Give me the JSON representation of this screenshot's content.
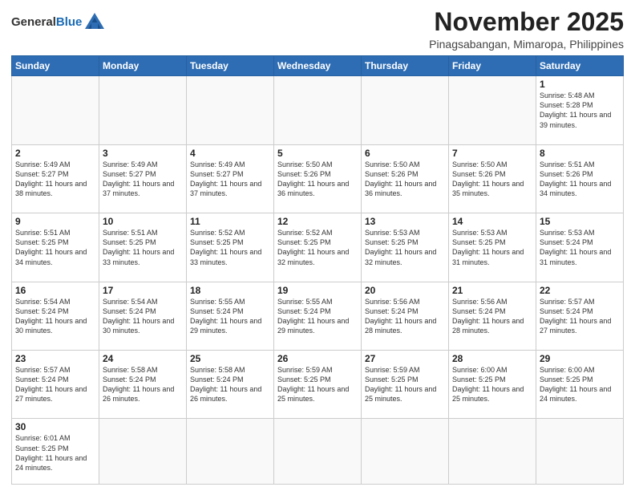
{
  "header": {
    "logo_general": "General",
    "logo_blue": "Blue",
    "month": "November 2025",
    "location": "Pinagsabangan, Mimaropa, Philippines"
  },
  "weekdays": [
    "Sunday",
    "Monday",
    "Tuesday",
    "Wednesday",
    "Thursday",
    "Friday",
    "Saturday"
  ],
  "weeks": [
    [
      {
        "day": "",
        "info": ""
      },
      {
        "day": "",
        "info": ""
      },
      {
        "day": "",
        "info": ""
      },
      {
        "day": "",
        "info": ""
      },
      {
        "day": "",
        "info": ""
      },
      {
        "day": "",
        "info": ""
      },
      {
        "day": "1",
        "info": "Sunrise: 5:48 AM\nSunset: 5:28 PM\nDaylight: 11 hours\nand 39 minutes."
      }
    ],
    [
      {
        "day": "2",
        "info": "Sunrise: 5:49 AM\nSunset: 5:27 PM\nDaylight: 11 hours\nand 38 minutes."
      },
      {
        "day": "3",
        "info": "Sunrise: 5:49 AM\nSunset: 5:27 PM\nDaylight: 11 hours\nand 37 minutes."
      },
      {
        "day": "4",
        "info": "Sunrise: 5:49 AM\nSunset: 5:27 PM\nDaylight: 11 hours\nand 37 minutes."
      },
      {
        "day": "5",
        "info": "Sunrise: 5:50 AM\nSunset: 5:26 PM\nDaylight: 11 hours\nand 36 minutes."
      },
      {
        "day": "6",
        "info": "Sunrise: 5:50 AM\nSunset: 5:26 PM\nDaylight: 11 hours\nand 36 minutes."
      },
      {
        "day": "7",
        "info": "Sunrise: 5:50 AM\nSunset: 5:26 PM\nDaylight: 11 hours\nand 35 minutes."
      },
      {
        "day": "8",
        "info": "Sunrise: 5:51 AM\nSunset: 5:26 PM\nDaylight: 11 hours\nand 34 minutes."
      }
    ],
    [
      {
        "day": "9",
        "info": "Sunrise: 5:51 AM\nSunset: 5:25 PM\nDaylight: 11 hours\nand 34 minutes."
      },
      {
        "day": "10",
        "info": "Sunrise: 5:51 AM\nSunset: 5:25 PM\nDaylight: 11 hours\nand 33 minutes."
      },
      {
        "day": "11",
        "info": "Sunrise: 5:52 AM\nSunset: 5:25 PM\nDaylight: 11 hours\nand 33 minutes."
      },
      {
        "day": "12",
        "info": "Sunrise: 5:52 AM\nSunset: 5:25 PM\nDaylight: 11 hours\nand 32 minutes."
      },
      {
        "day": "13",
        "info": "Sunrise: 5:53 AM\nSunset: 5:25 PM\nDaylight: 11 hours\nand 32 minutes."
      },
      {
        "day": "14",
        "info": "Sunrise: 5:53 AM\nSunset: 5:25 PM\nDaylight: 11 hours\nand 31 minutes."
      },
      {
        "day": "15",
        "info": "Sunrise: 5:53 AM\nSunset: 5:24 PM\nDaylight: 11 hours\nand 31 minutes."
      }
    ],
    [
      {
        "day": "16",
        "info": "Sunrise: 5:54 AM\nSunset: 5:24 PM\nDaylight: 11 hours\nand 30 minutes."
      },
      {
        "day": "17",
        "info": "Sunrise: 5:54 AM\nSunset: 5:24 PM\nDaylight: 11 hours\nand 30 minutes."
      },
      {
        "day": "18",
        "info": "Sunrise: 5:55 AM\nSunset: 5:24 PM\nDaylight: 11 hours\nand 29 minutes."
      },
      {
        "day": "19",
        "info": "Sunrise: 5:55 AM\nSunset: 5:24 PM\nDaylight: 11 hours\nand 29 minutes."
      },
      {
        "day": "20",
        "info": "Sunrise: 5:56 AM\nSunset: 5:24 PM\nDaylight: 11 hours\nand 28 minutes."
      },
      {
        "day": "21",
        "info": "Sunrise: 5:56 AM\nSunset: 5:24 PM\nDaylight: 11 hours\nand 28 minutes."
      },
      {
        "day": "22",
        "info": "Sunrise: 5:57 AM\nSunset: 5:24 PM\nDaylight: 11 hours\nand 27 minutes."
      }
    ],
    [
      {
        "day": "23",
        "info": "Sunrise: 5:57 AM\nSunset: 5:24 PM\nDaylight: 11 hours\nand 27 minutes."
      },
      {
        "day": "24",
        "info": "Sunrise: 5:58 AM\nSunset: 5:24 PM\nDaylight: 11 hours\nand 26 minutes."
      },
      {
        "day": "25",
        "info": "Sunrise: 5:58 AM\nSunset: 5:24 PM\nDaylight: 11 hours\nand 26 minutes."
      },
      {
        "day": "26",
        "info": "Sunrise: 5:59 AM\nSunset: 5:25 PM\nDaylight: 11 hours\nand 25 minutes."
      },
      {
        "day": "27",
        "info": "Sunrise: 5:59 AM\nSunset: 5:25 PM\nDaylight: 11 hours\nand 25 minutes."
      },
      {
        "day": "28",
        "info": "Sunrise: 6:00 AM\nSunset: 5:25 PM\nDaylight: 11 hours\nand 25 minutes."
      },
      {
        "day": "29",
        "info": "Sunrise: 6:00 AM\nSunset: 5:25 PM\nDaylight: 11 hours\nand 24 minutes."
      }
    ],
    [
      {
        "day": "30",
        "info": "Sunrise: 6:01 AM\nSunset: 5:25 PM\nDaylight: 11 hours\nand 24 minutes."
      },
      {
        "day": "",
        "info": ""
      },
      {
        "day": "",
        "info": ""
      },
      {
        "day": "",
        "info": ""
      },
      {
        "day": "",
        "info": ""
      },
      {
        "day": "",
        "info": ""
      },
      {
        "day": "",
        "info": ""
      }
    ]
  ]
}
